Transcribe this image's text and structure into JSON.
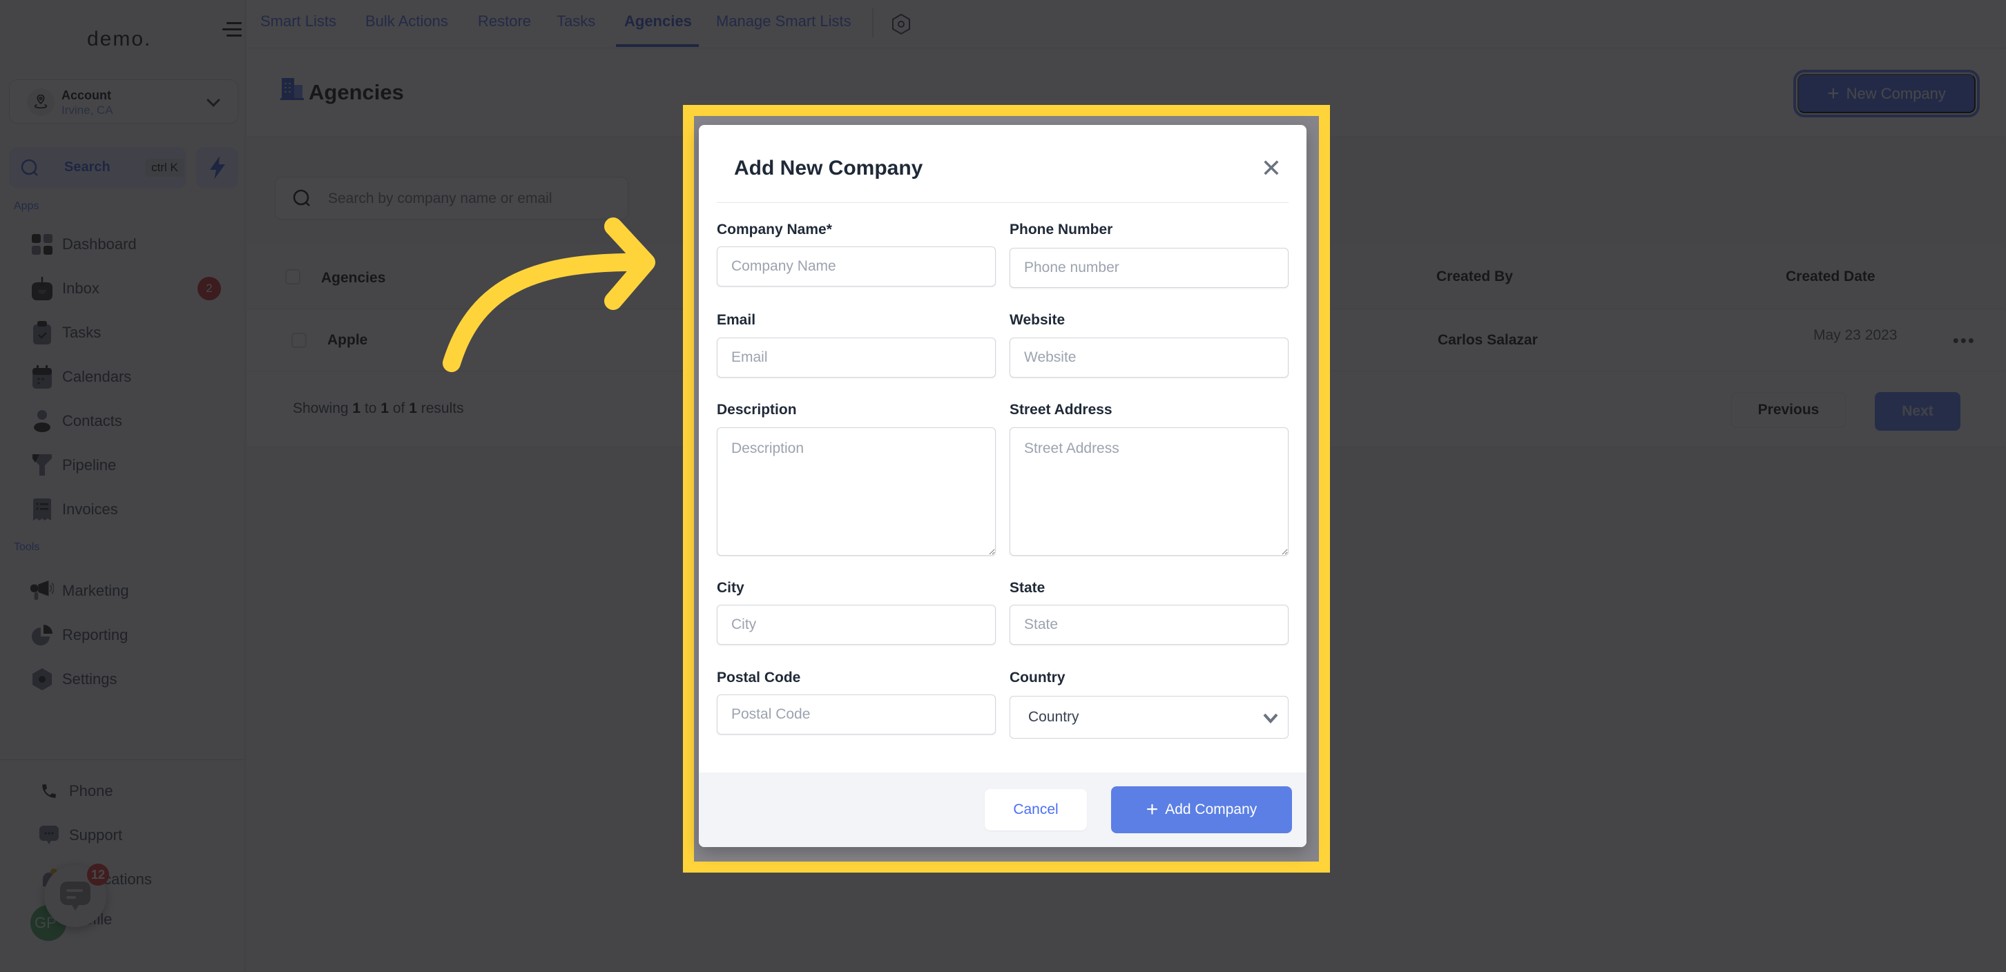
{
  "app": {
    "logo": "demo.",
    "account": {
      "name": "Account",
      "location": "Irvine, CA"
    },
    "search": {
      "label": "Search",
      "shortcut": "ctrl K"
    }
  },
  "sidebar": {
    "apps_label": "Apps",
    "tools_label": "Tools",
    "apps": [
      {
        "label": "Dashboard",
        "icon": "dashboard-icon"
      },
      {
        "label": "Inbox",
        "icon": "inbox-icon",
        "badge": "2"
      },
      {
        "label": "Tasks",
        "icon": "tasks-icon"
      },
      {
        "label": "Calendars",
        "icon": "calendar-icon"
      },
      {
        "label": "Contacts",
        "icon": "contacts-icon"
      },
      {
        "label": "Pipeline",
        "icon": "pipeline-icon"
      },
      {
        "label": "Invoices",
        "icon": "invoices-icon"
      }
    ],
    "tools": [
      {
        "label": "Marketing",
        "icon": "megaphone-icon"
      },
      {
        "label": "Reporting",
        "icon": "pie-chart-icon"
      },
      {
        "label": "Settings",
        "icon": "settings-icon"
      }
    ],
    "bottom": [
      {
        "label": "Phone",
        "icon": "phone-icon"
      },
      {
        "label": "Support",
        "icon": "chat-bubble-icon"
      },
      {
        "label": "Notifications",
        "icon": "bell-icon"
      },
      {
        "label": "Profile",
        "icon": "avatar"
      }
    ],
    "avatar_initials": "GP",
    "chat_widget_count": "12"
  },
  "topnav": {
    "tabs": [
      {
        "label": "Smart Lists",
        "active": false
      },
      {
        "label": "Bulk Actions",
        "active": false
      },
      {
        "label": "Restore",
        "active": false
      },
      {
        "label": "Tasks",
        "active": false
      },
      {
        "label": "Agencies",
        "active": true
      },
      {
        "label": "Manage Smart Lists",
        "active": false
      }
    ]
  },
  "page": {
    "title": "Agencies",
    "new_button": "New Company",
    "search_placeholder": "Search by company name or email"
  },
  "table": {
    "columns": [
      "Agencies",
      "Created By",
      "Created Date"
    ],
    "rows": [
      {
        "agency": "Apple",
        "created_by": "Carlos Salazar",
        "created_date": "May 23 2023"
      }
    ],
    "footer": {
      "prefix": "Showing",
      "from": "1",
      "to_word": "to",
      "to": "1",
      "of_word": "of",
      "total": "1",
      "suffix": "results"
    },
    "prev_label": "Previous",
    "next_label": "Next"
  },
  "modal": {
    "title": "Add New Company",
    "fields": {
      "company_name": {
        "label": "Company Name*",
        "placeholder": "Company Name",
        "value": ""
      },
      "phone": {
        "label": "Phone Number",
        "placeholder": "Phone number",
        "value": ""
      },
      "email": {
        "label": "Email",
        "placeholder": "Email",
        "value": ""
      },
      "website": {
        "label": "Website",
        "placeholder": "Website",
        "value": ""
      },
      "description": {
        "label": "Description",
        "placeholder": "Description",
        "value": ""
      },
      "street": {
        "label": "Street Address",
        "placeholder": "Street Address",
        "value": ""
      },
      "city": {
        "label": "City",
        "placeholder": "City",
        "value": ""
      },
      "state": {
        "label": "State",
        "placeholder": "State",
        "value": ""
      },
      "postal": {
        "label": "Postal Code",
        "placeholder": "Postal Code",
        "value": ""
      },
      "country": {
        "label": "Country",
        "selected": "Country"
      }
    },
    "cancel_label": "Cancel",
    "submit_label": "Add Company"
  },
  "colors": {
    "accent": "#4c6ef5",
    "submit": "#5b7fe5",
    "highlight": "#ffd43b",
    "badge": "#c92a2a"
  }
}
